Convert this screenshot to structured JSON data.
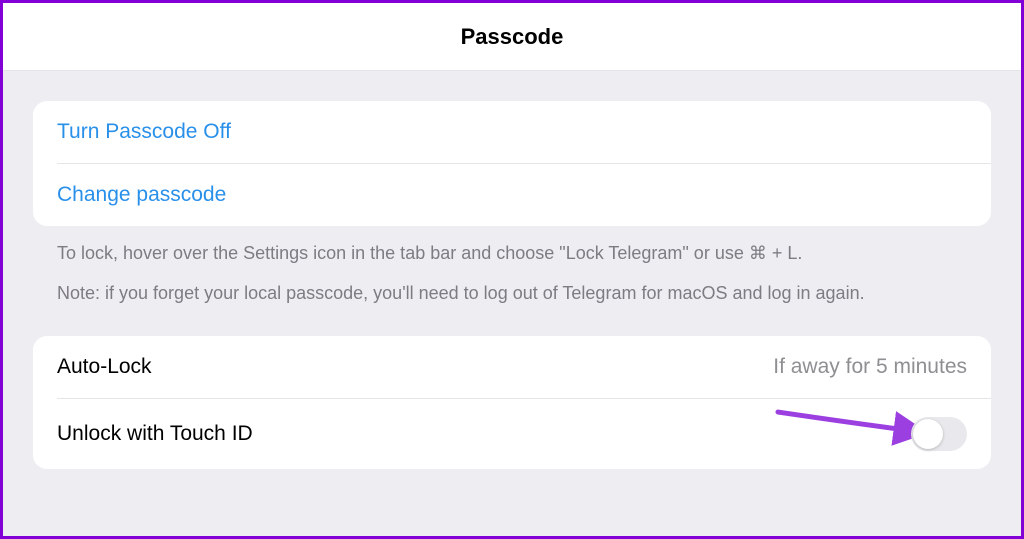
{
  "header": {
    "title": "Passcode"
  },
  "section1": {
    "turnOffLabel": "Turn Passcode Off",
    "changeLabel": "Change passcode"
  },
  "footer": {
    "line1": "To lock, hover over the Settings icon in the tab bar and choose \"Lock Telegram\" or use ⌘ + L.",
    "line2": "Note: if you forget your local passcode, you'll need to log out of Telegram for macOS and log in again."
  },
  "section2": {
    "autoLockLabel": "Auto-Lock",
    "autoLockValue": "If away for 5 minutes",
    "touchIdLabel": "Unlock with Touch ID",
    "touchIdEnabled": false
  },
  "annotation": {
    "arrowColor": "#9b3fe0"
  }
}
